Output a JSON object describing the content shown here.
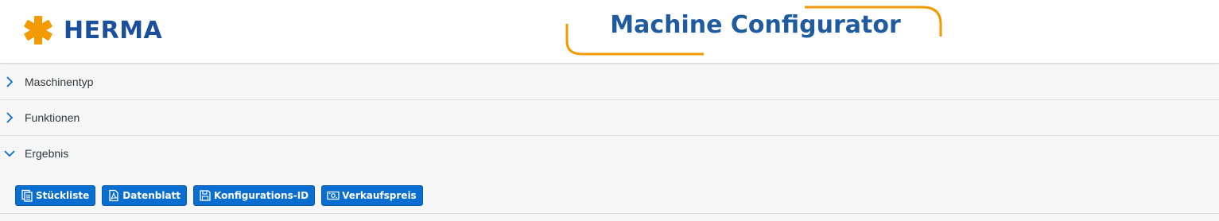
{
  "header": {
    "brand": "HERMA",
    "title": "Machine Configurator",
    "colors": {
      "brand_blue": "#1b4f9c",
      "title_blue": "#1f5b9e",
      "accent_orange": "#f29a00"
    }
  },
  "panels": [
    {
      "label": "Maschinentyp",
      "expanded": false,
      "icon": "chevron-right-icon"
    },
    {
      "label": "Funktionen",
      "expanded": false,
      "icon": "chevron-right-icon"
    },
    {
      "label": "Ergebnis",
      "expanded": true,
      "icon": "chevron-down-icon"
    }
  ],
  "result_buttons": [
    {
      "label": "Stückliste",
      "icon": "bill-of-materials-icon"
    },
    {
      "label": "Datenblatt",
      "icon": "pdf-document-icon"
    },
    {
      "label": "Konfigurations-ID",
      "icon": "save-icon"
    },
    {
      "label": "Verkaufspreis",
      "icon": "money-bills-icon"
    }
  ],
  "colors": {
    "button_blue": "#0a6ed1",
    "chevron_blue": "#0a6ed1"
  }
}
